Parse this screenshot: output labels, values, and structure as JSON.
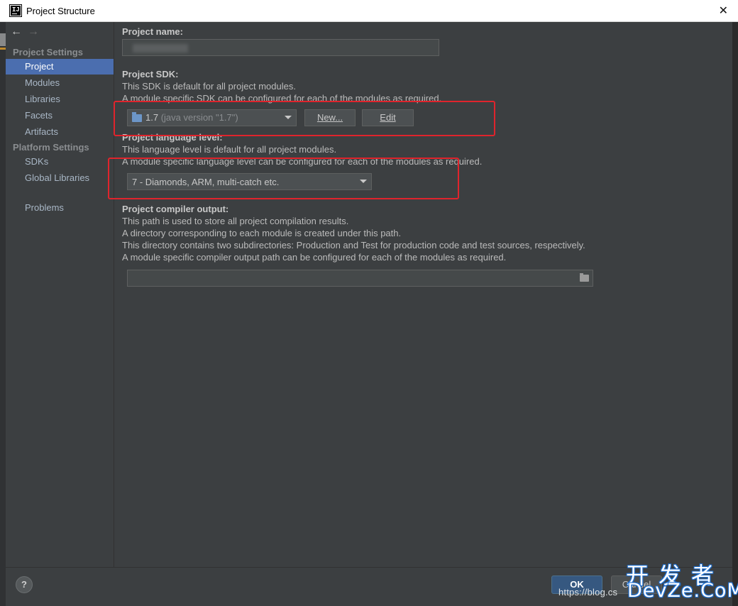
{
  "window": {
    "title": "Project Structure",
    "close_glyph": "✕"
  },
  "nav": {
    "back": "←",
    "forward": "→"
  },
  "sidebar": {
    "project_settings_header": "Project Settings",
    "project_items": [
      "Project",
      "Modules",
      "Libraries",
      "Facets",
      "Artifacts"
    ],
    "selected": "Project",
    "platform_settings_header": "Platform Settings",
    "platform_items": [
      "SDKs",
      "Global Libraries"
    ],
    "problems": "Problems"
  },
  "main": {
    "project_name": {
      "label": "Project name:",
      "value": ""
    },
    "sdk": {
      "label": "Project SDK:",
      "desc1": "This SDK is default for all project modules.",
      "desc2": "A module specific SDK can be configured for each of the modules as required.",
      "selected_version": "1.7",
      "selected_detail": "(java version \"1.7\")",
      "new_button": "New...",
      "edit_button": "Edit"
    },
    "language_level": {
      "label": "Project language level:",
      "desc1": "This language level is default for all project modules.",
      "desc2": "A module specific language level can be configured for each of the modules as required.",
      "selected": "7 - Diamonds, ARM, multi-catch etc."
    },
    "compiler_output": {
      "label": "Project compiler output:",
      "desc1": "This path is used to store all project compilation results.",
      "desc2": "A directory corresponding to each module is created under this path.",
      "desc3": "This directory contains two subdirectories: Production and Test for production code and test sources, respectively.",
      "desc4": "A module specific compiler output path can be configured for each of the modules as required.",
      "path_value": ""
    }
  },
  "footer": {
    "help": "?",
    "ok": "OK",
    "cancel": "Cancel"
  },
  "watermark": {
    "url": "https://blog.cs",
    "cn": "开发者",
    "en": "DevZe.CoM"
  },
  "colors": {
    "selection": "#4b6eaf",
    "highlight_box": "#e0242c",
    "ok_button": "#365880"
  }
}
